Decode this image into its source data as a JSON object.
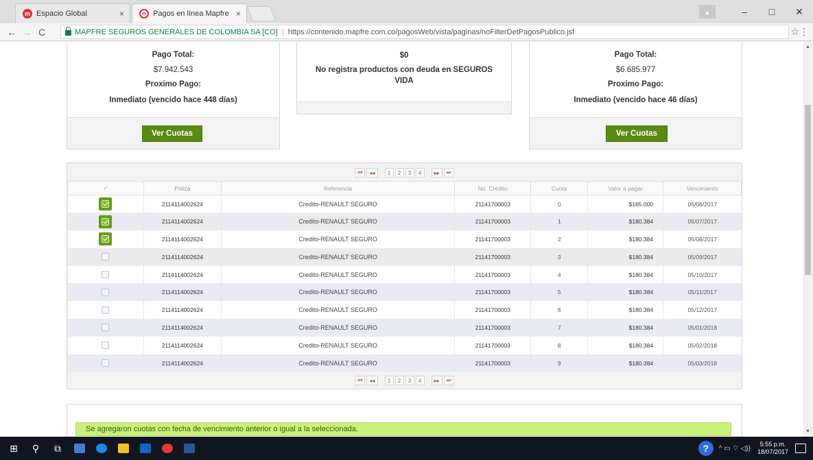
{
  "browser": {
    "tabs": [
      {
        "title": "Espacio Global",
        "close": "×"
      },
      {
        "title": "Pagos en línea Mapfre",
        "close": "×"
      }
    ],
    "window_controls": {
      "profile": "▴",
      "minimize": "–",
      "maximize": "□",
      "close": "✕"
    },
    "nav": {
      "back": "←",
      "forward": "→",
      "reload": "C"
    },
    "cert_name": "MAPFRE SEGUROS GENERALES DE COLOMBIA SA [CO]",
    "url_separator": "|",
    "url": "https://contenido.mapfre.com.co/pagosWeb/vista/paginas/noFilterDetPagosPublico.jsf",
    "star": "☆",
    "menu": "⋮"
  },
  "cards": {
    "left": {
      "label_total": "Pago Total:",
      "total": "$7.942.543",
      "label_next": "Proximo Pago:",
      "next": "Inmediato (vencido hace 448 días)",
      "button": "Ver Cuotas"
    },
    "middle": {
      "amount": "$0",
      "message_line1": "No registra productos con deuda en SEGUROS",
      "message_line2": "VIDA"
    },
    "right": {
      "label_total": "Pago Total:",
      "total": "$6.685.977",
      "label_next": "Proximo Pago:",
      "next": "Inmediato (vencido hace 46 días)",
      "button": "Ver Cuotas"
    }
  },
  "pager": {
    "first": "⏮",
    "prev": "◂◂",
    "next": "▸▸",
    "last": "⏭",
    "pages": [
      "1",
      "2",
      "3",
      "4"
    ]
  },
  "table": {
    "headers": {
      "check": "✓",
      "poliza": "Póliza",
      "referencia": "Referencia",
      "credito": "No. Crédito",
      "cuota": "Cuota",
      "valor": "Valor a pagar",
      "vencimiento": "Vencimiento"
    },
    "rows": [
      {
        "checked": true,
        "poliza": "2114114002624",
        "referencia": "Credito-RENAULT SEGURO",
        "credito": "21141700003",
        "cuota": "0",
        "valor": "$165.000",
        "vencimiento": "05/06/2017"
      },
      {
        "checked": true,
        "poliza": "2114114002624",
        "referencia": "Credito-RENAULT SEGURO",
        "credito": "21141700003",
        "cuota": "1",
        "valor": "$180.384",
        "vencimiento": "05/07/2017"
      },
      {
        "checked": true,
        "poliza": "2114114002624",
        "referencia": "Credito-RENAULT SEGURO",
        "credito": "21141700003",
        "cuota": "2",
        "valor": "$180.384",
        "vencimiento": "05/08/2017"
      },
      {
        "checked": false,
        "poliza": "2114114002624",
        "referencia": "Credito-RENAULT SEGURO",
        "credito": "21141700003",
        "cuota": "3",
        "valor": "$180.384",
        "vencimiento": "05/09/2017"
      },
      {
        "checked": false,
        "poliza": "2114114002624",
        "referencia": "Credito-RENAULT SEGURO",
        "credito": "21141700003",
        "cuota": "4",
        "valor": "$180.384",
        "vencimiento": "05/10/2017"
      },
      {
        "checked": false,
        "poliza": "2114114002624",
        "referencia": "Credito-RENAULT SEGURO",
        "credito": "21141700003",
        "cuota": "5",
        "valor": "$180.384",
        "vencimiento": "05/11/2017"
      },
      {
        "checked": false,
        "poliza": "2114114002624",
        "referencia": "Credito-RENAULT SEGURO",
        "credito": "21141700003",
        "cuota": "6",
        "valor": "$180.384",
        "vencimiento": "05/12/2017"
      },
      {
        "checked": false,
        "poliza": "2114114002624",
        "referencia": "Credito-RENAULT SEGURO",
        "credito": "21141700003",
        "cuota": "7",
        "valor": "$180.384",
        "vencimiento": "05/01/2018"
      },
      {
        "checked": false,
        "poliza": "2114114002624",
        "referencia": "Credito-RENAULT SEGURO",
        "credito": "21141700003",
        "cuota": "8",
        "valor": "$180.384",
        "vencimiento": "05/02/2018"
      },
      {
        "checked": false,
        "poliza": "2114114002624",
        "referencia": "Credito-RENAULT SEGURO",
        "credito": "21141700003",
        "cuota": "9",
        "valor": "$180.384",
        "vencimiento": "05/03/2018"
      }
    ]
  },
  "notice": "Se agregaron cuotas con fecha de vencimiento anterior o igual a la seleccionada.",
  "taskbar": {
    "start": "⊞",
    "search": "⚲",
    "task_view": "⧉",
    "help": "?",
    "tray_icons": "^ ▭ ⌔ ◁))",
    "time": "5:55 p.m.",
    "date": "18/07/2017"
  },
  "colors": {
    "accent_green": "#5a8a12",
    "notice_bg": "#c9f07a",
    "mapfre_red": "#d9312c"
  }
}
